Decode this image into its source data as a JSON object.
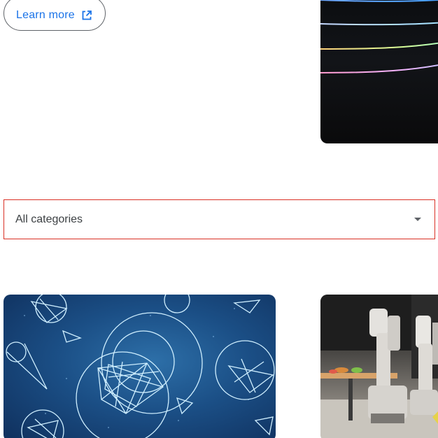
{
  "learn_more": {
    "label": "Learn more",
    "icon": "open-in-new-icon",
    "color": "#1a73e8"
  },
  "filter": {
    "selected": "All categories",
    "border_color": "#d93025",
    "icon": "arrow-drop-down-icon"
  },
  "images": {
    "hero": "neon-lines-image",
    "card_one": "geometric-shapes-image",
    "card_two": "robots-image"
  }
}
